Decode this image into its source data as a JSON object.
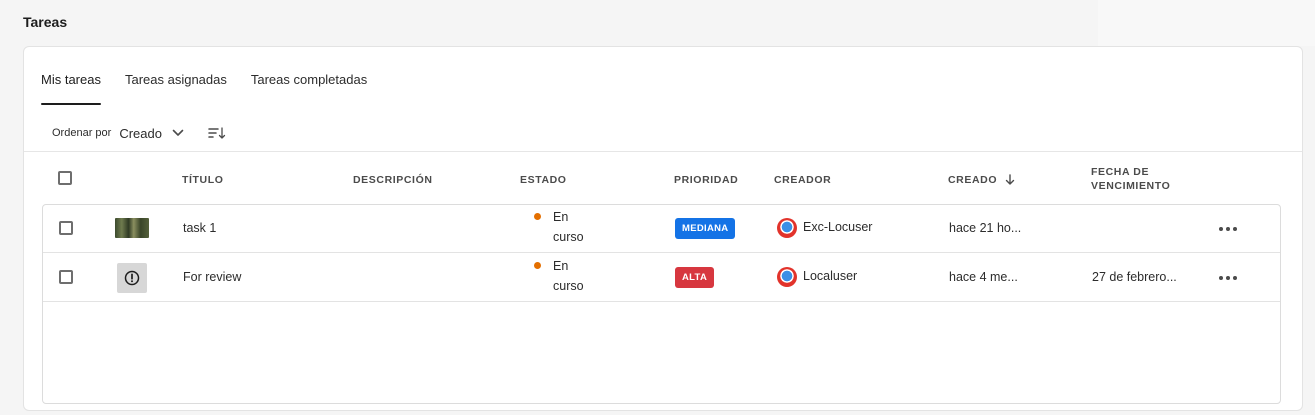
{
  "page": {
    "title": "Tareas"
  },
  "tabs": [
    {
      "label": "Mis tareas",
      "active": true
    },
    {
      "label": "Tareas asignadas",
      "active": false
    },
    {
      "label": "Tareas completadas",
      "active": false
    }
  ],
  "sort": {
    "label": "Ordenar por",
    "value": "Creado"
  },
  "columns": {
    "title": "Título",
    "description": "Descripción",
    "status": "Estado",
    "priority": "Prioridad",
    "creator": "Creador",
    "created": "Creado",
    "due_line1": "Fecha de",
    "due_line2": "vencimiento"
  },
  "rows": [
    {
      "title": "task 1",
      "description": "",
      "status_line1": "En",
      "status_line2": "curso",
      "priority": "MEDIANA",
      "priority_color": "#1473e6",
      "creator": "Exc-Locuser",
      "created": "hace 21 ho...",
      "due": ""
    },
    {
      "title": "For review",
      "description": "",
      "status_line1": "En",
      "status_line2": "curso",
      "priority": "ALTA",
      "priority_color": "#d7373f",
      "creator": "Localuser",
      "created": "hace 4 me...",
      "due": "27 de febrero..."
    }
  ],
  "colors": {
    "status_in_progress": "#e46f00"
  },
  "icons": {
    "sort_dropdown": "chevron-down-icon",
    "sort_order": "sort-descending-icon",
    "created_sort": "arrow-down-icon",
    "row_action": "more-icon",
    "alert": "alert-circle-icon"
  }
}
